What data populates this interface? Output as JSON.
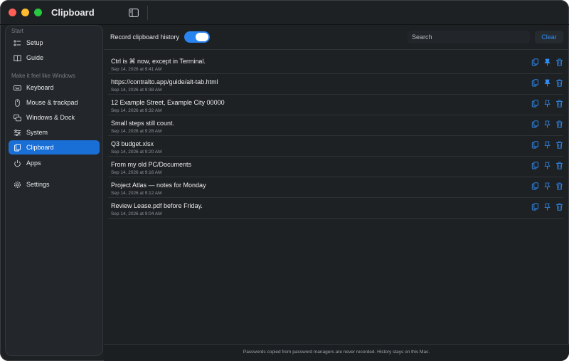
{
  "window": {
    "title": "Clipboard",
    "controls": [
      "close",
      "minimize",
      "zoom"
    ]
  },
  "sidebar": {
    "sections": [
      {
        "label": "Start"
      },
      {
        "label": "Make it feel like Windows"
      }
    ],
    "items": [
      {
        "label": "Setup",
        "icon": "checklist-icon"
      },
      {
        "label": "Guide",
        "icon": "book-icon"
      },
      {
        "label": "Keyboard",
        "icon": "keyboard-icon"
      },
      {
        "label": "Mouse & trackpad",
        "icon": "mouse-icon"
      },
      {
        "label": "Windows & Dock",
        "icon": "windows-icon"
      },
      {
        "label": "System",
        "icon": "sliders-icon"
      },
      {
        "label": "Clipboard",
        "icon": "clipboard-icon",
        "active": true
      },
      {
        "label": "Apps",
        "icon": "power-icon"
      },
      {
        "label": "Settings",
        "icon": "gear-icon"
      }
    ]
  },
  "toolbar": {
    "record_label": "Record clipboard history",
    "record_enabled": true,
    "search_placeholder": "Search",
    "clear_label": "Clear"
  },
  "clips": [
    {
      "text": "Ctrl is ⌘ now, except in Terminal.",
      "time": "Sep 14, 2026 at 9:41 AM",
      "pinned": true
    },
    {
      "text": "https://contralto.app/guide/alt-tab.html",
      "time": "Sep 14, 2026 at 9:38 AM",
      "pinned": true
    },
    {
      "text": "12 Example Street, Example City 00000",
      "time": "Sep 14, 2026 at 9:32 AM",
      "pinned": false
    },
    {
      "text": "Small steps still count.",
      "time": "Sep 14, 2026 at 9:28 AM",
      "pinned": false
    },
    {
      "text": "Q3 budget.xlsx",
      "time": "Sep 14, 2026 at 9:20 AM",
      "pinned": false
    },
    {
      "text": "From my old PC/Documents",
      "time": "Sep 14, 2026 at 9:16 AM",
      "pinned": false
    },
    {
      "text": "Project Atlas — notes for Monday",
      "time": "Sep 14, 2026 at 9:12 AM",
      "pinned": false
    },
    {
      "text": "Review Lease.pdf before Friday.",
      "time": "Sep 14, 2026 at 9:04 AM",
      "pinned": false
    }
  ],
  "footer": {
    "text": "Passwords copied from password managers are never recorded. History stays on this Mac."
  },
  "colors": {
    "accent": "#2a84f0",
    "active_item": "#1a6fd6",
    "background": "#1e2124",
    "sidebar": "#23272b"
  }
}
